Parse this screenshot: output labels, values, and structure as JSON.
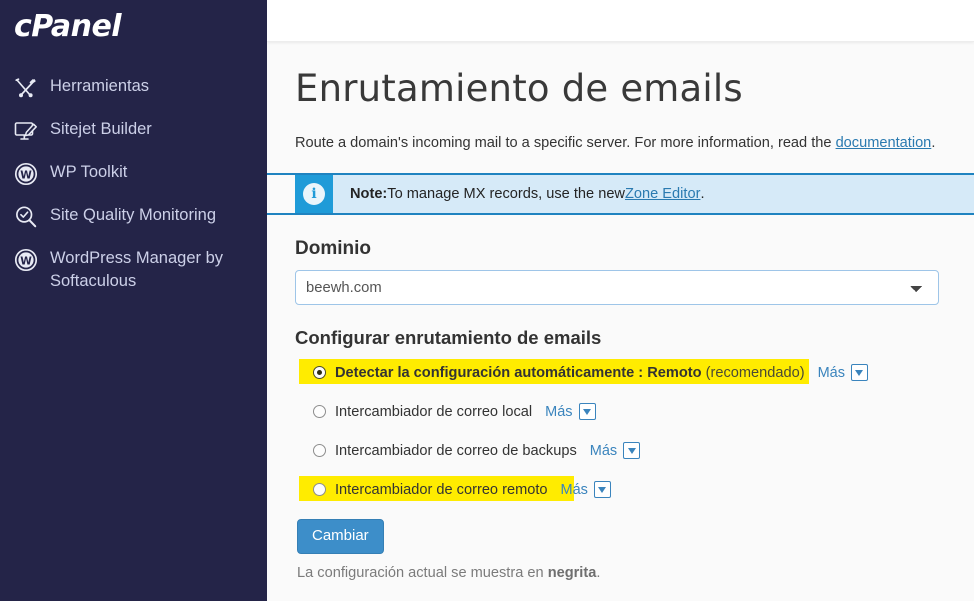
{
  "sidebar": {
    "brand": "cPanel",
    "items": [
      {
        "label": "Herramientas",
        "icon": "tools-icon"
      },
      {
        "label": "Sitejet Builder",
        "icon": "monitor-pen-icon"
      },
      {
        "label": "WP Toolkit",
        "icon": "wordpress-icon"
      },
      {
        "label": "Site Quality Monitoring",
        "icon": "magnifier-check-icon"
      },
      {
        "label": "WordPress Manager by Softaculous",
        "icon": "wordpress-icon"
      }
    ]
  },
  "page": {
    "title": "Enrutamiento de emails",
    "intro_before": "Route a domain's incoming mail to a specific server. For more information, read the ",
    "intro_link": "documentation",
    "intro_after": "."
  },
  "note": {
    "icon": "info-icon",
    "icon_glyph": "i",
    "label": "Note:",
    "text_before": " To manage MX records, use the new ",
    "link": "Zone Editor",
    "text_after": "."
  },
  "domain": {
    "label": "Dominio",
    "selected": "beewh.com",
    "options": [
      "beewh.com"
    ]
  },
  "routing": {
    "heading": "Configurar enrutamiento de emails",
    "more_label": "Más",
    "options": [
      {
        "label": "Detectar la configuración automáticamente : Remoto",
        "suffix": " (recomendado)",
        "selected": true,
        "bold": true,
        "highlight": true,
        "highlight_width": 510
      },
      {
        "label": "Intercambiador de correo local",
        "suffix": "",
        "selected": false,
        "bold": false,
        "highlight": false,
        "highlight_width": 0
      },
      {
        "label": "Intercambiador de correo de backups",
        "suffix": "",
        "selected": false,
        "bold": false,
        "highlight": false,
        "highlight_width": 0
      },
      {
        "label": "Intercambiador de correo remoto",
        "suffix": "",
        "selected": false,
        "bold": false,
        "highlight": true,
        "highlight_width": 275
      }
    ]
  },
  "actions": {
    "submit_label": "Cambiar",
    "footnote_before": "La configuración actual se muestra en ",
    "footnote_bold": "negrita",
    "footnote_after": "."
  },
  "colors": {
    "sidebar_bg": "#242448",
    "accent_blue": "#3d8ec9",
    "note_bg": "#d6eaf8",
    "note_border": "#1f83c0",
    "highlight": "#ffec00",
    "link": "#2a7ab0"
  }
}
